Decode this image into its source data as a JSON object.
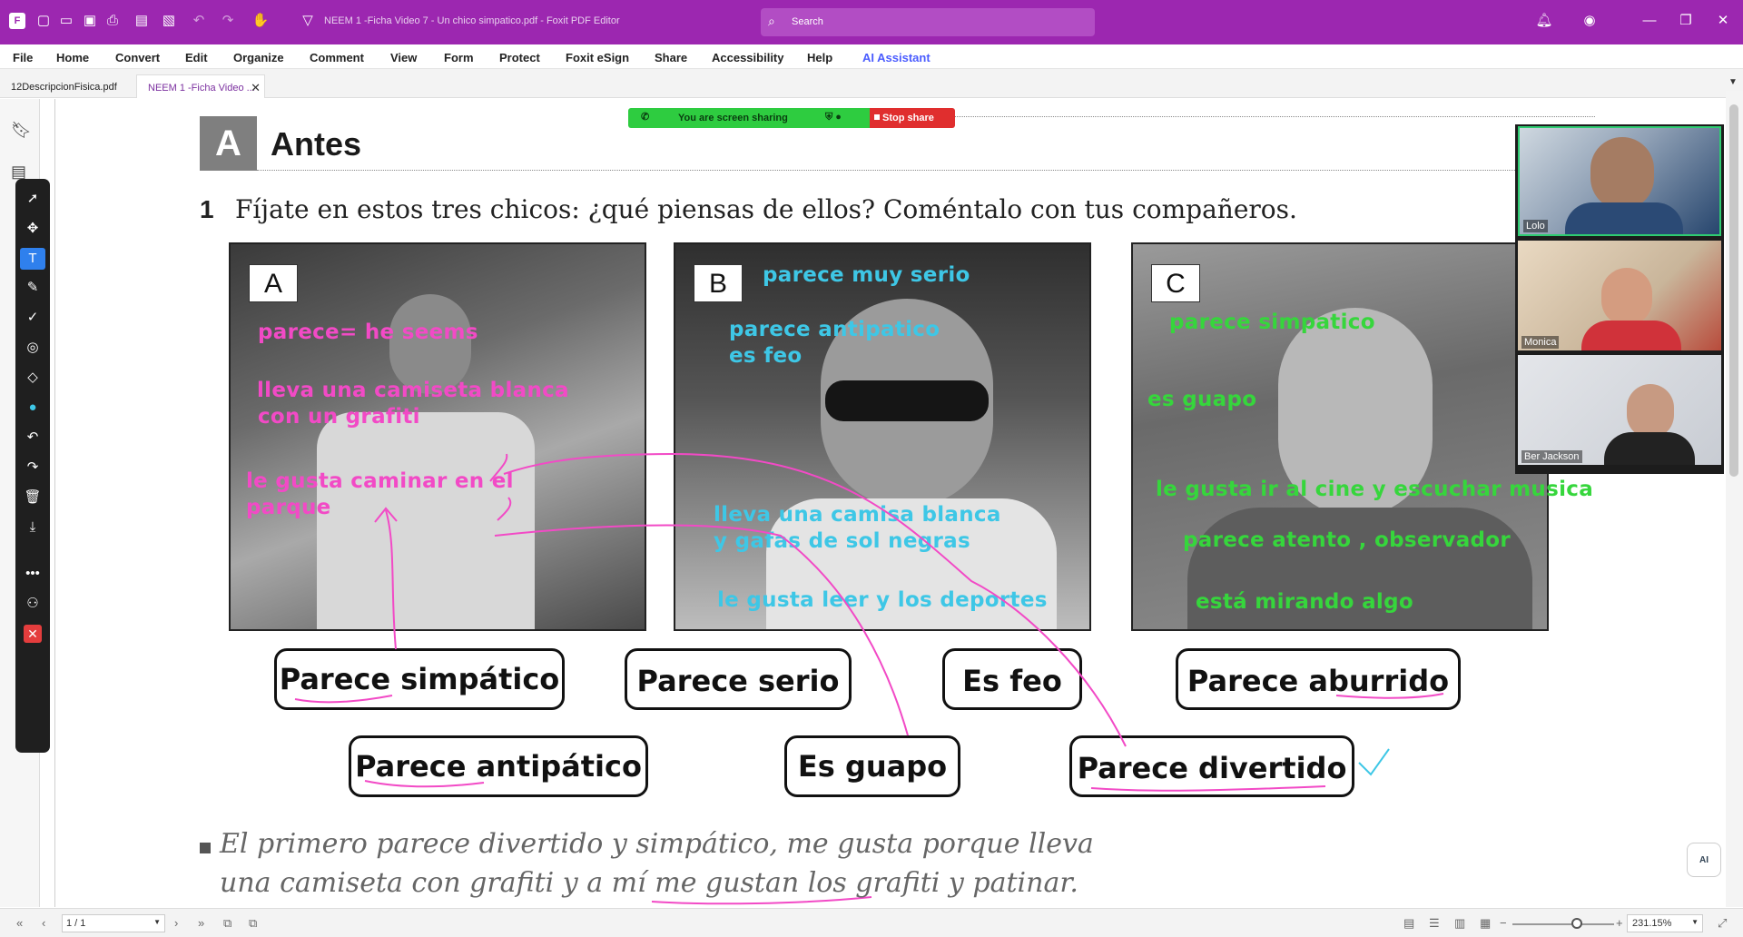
{
  "window": {
    "title": "NEEM 1 -Ficha Video  7 - Un chico simpatico.pdf - Foxit PDF Editor",
    "search_placeholder": "Search"
  },
  "menu": [
    "File",
    "Home",
    "Convert",
    "Edit",
    "Organize",
    "Comment",
    "View",
    "Form",
    "Protect",
    "Foxit eSign",
    "Share",
    "Accessibility",
    "Help",
    "AI Assistant"
  ],
  "tabs": [
    {
      "label": "12DescripcionFisica.pdf"
    },
    {
      "label": "NEEM 1 -Ficha Video ..."
    }
  ],
  "screen_share": {
    "status": "You are screen sharing",
    "stop_label": "Stop share"
  },
  "document": {
    "section_letter": "A",
    "section_title": "Antes",
    "question_number": "1",
    "question_text": "Fíjate en estos tres chicos: ¿qué piensas de ellos? Coméntalo con tus compañeros.",
    "photo_labels": [
      "A",
      "B",
      "C"
    ],
    "annotations_a": [
      "parece= he seems",
      "lleva una camiseta blanca",
      "con un grafiti",
      "le gusta caminar  en el",
      "parque"
    ],
    "annotations_b": [
      "parece muy serio",
      "parece antipatico",
      "es feo",
      "lleva una camisa blanca",
      "y gafas de sol negras",
      "le gusta leer y los deportes"
    ],
    "annotations_c": [
      "parece simpatico",
      "es guapo",
      "le gusta ir al cine y escuchar musica",
      "parece atento  , observador",
      "está mirando algo"
    ],
    "labels_row1": [
      "Parece simpático",
      "Parece serio",
      "Es feo",
      "Parece aburrido"
    ],
    "labels_row2": [
      "Parece antipático",
      "Es guapo",
      "Parece divertido"
    ],
    "example_line1": "El primero parece divertido y simpático, me gusta porque lleva",
    "example_line2": "una camiseta con grafiti y a mí me gustan los grafiti y patinar."
  },
  "participants": [
    {
      "name": "Lolo"
    },
    {
      "name": "Monica"
    },
    {
      "name": "Ber Jackson"
    }
  ],
  "status_bar": {
    "page": "1 / 1",
    "zoom": "231.15%"
  },
  "colors": {
    "titlebar": "#9c27b0",
    "pink_ink": "#f24ac6",
    "cyan_ink": "#3ec7e6",
    "green_ink": "#36d63c",
    "share_green": "#2ecc40",
    "share_red": "#e02e2e"
  },
  "ai_button": "AI"
}
